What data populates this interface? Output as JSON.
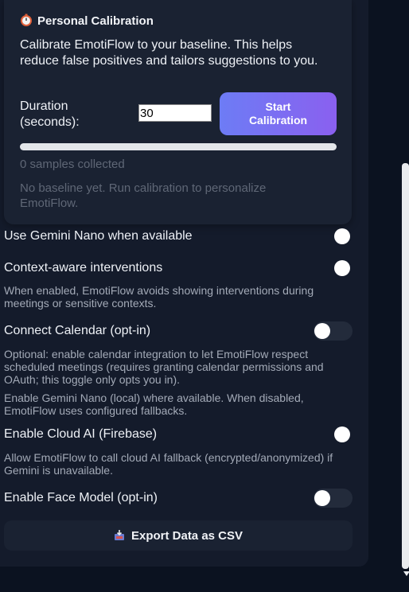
{
  "calibration": {
    "title": "Personal Calibration",
    "title_icon": "stopwatch-icon",
    "description": "Calibrate EmotiFlow to your baseline. This helps reduce false positives and tailors suggestions to you.",
    "duration_label": "Duration (seconds):",
    "duration_value": "30",
    "start_button": "Start\nCalibration",
    "progress_fraction": 0.0,
    "samples_text": "0 samples collected",
    "baseline_text": "No baseline yet. Run calibration to personalize EmotiFlow."
  },
  "settings": {
    "gemini_nano": {
      "label": "Use Gemini Nano when available",
      "enabled": true
    },
    "context_aware": {
      "label": "Context-aware interventions",
      "enabled": true,
      "help": "When enabled, EmotiFlow avoids showing interventions during meetings or sensitive contexts."
    },
    "calendar": {
      "label": "Connect Calendar (opt-in)",
      "enabled": false,
      "help": "Optional: enable calendar integration to let EmotiFlow respect scheduled meetings (requires granting calendar permissions and OAuth; this toggle only opts you in).",
      "help2": "Enable Gemini Nano (local) where available. When disabled, EmotiFlow uses configured fallbacks."
    },
    "cloud_ai": {
      "label": "Enable Cloud AI (Firebase)",
      "enabled": true,
      "help": "Allow EmotiFlow to call cloud AI fallback (encrypted/anonymized) if Gemini is unavailable."
    },
    "face_model": {
      "label": "Enable Face Model (opt-in)",
      "enabled": false
    }
  },
  "export": {
    "label": "Export Data as CSV",
    "icon": "inbox-tray-icon"
  },
  "colors": {
    "accent_start": "#6d7cf5",
    "accent_end": "#8a60ef",
    "panel": "#141b2b",
    "card": "#1a2232"
  }
}
